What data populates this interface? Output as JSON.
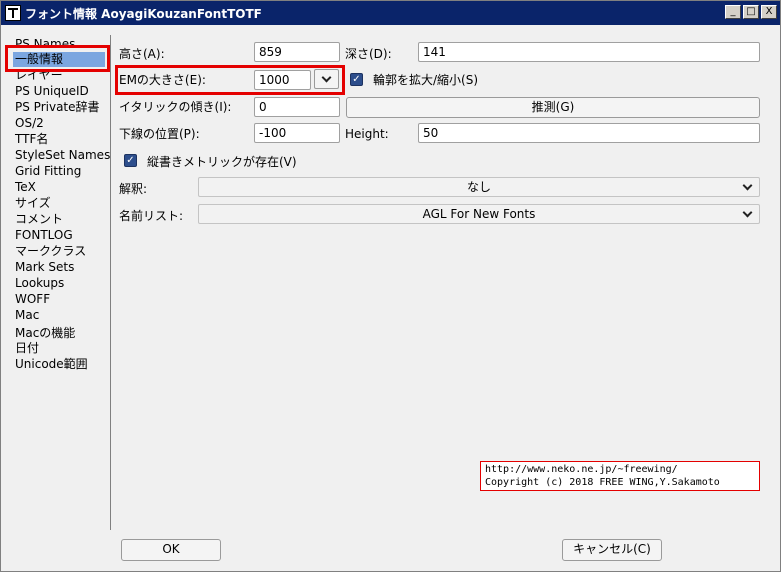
{
  "window": {
    "title": "フォント情報 AoyagiKouzanFontTOTF",
    "minimize_glyph": "_",
    "maximize_glyph": "□",
    "close_glyph": "X"
  },
  "sidebar": {
    "items": [
      {
        "label": "PS Names"
      },
      {
        "label": "一般情報",
        "selected": true
      },
      {
        "label": "レイヤー"
      },
      {
        "label": "PS UniqueID"
      },
      {
        "label": "PS Private辞書"
      },
      {
        "label": "OS/2"
      },
      {
        "label": "TTF名"
      },
      {
        "label": "StyleSet Names"
      },
      {
        "label": "Grid Fitting"
      },
      {
        "label": "TeX"
      },
      {
        "label": "サイズ"
      },
      {
        "label": "コメント"
      },
      {
        "label": "FONTLOG"
      },
      {
        "label": "マーククラス"
      },
      {
        "label": "Mark Sets"
      },
      {
        "label": "Lookups"
      },
      {
        "label": "WOFF"
      },
      {
        "label": "Mac"
      },
      {
        "label": "Macの機能"
      },
      {
        "label": "日付"
      },
      {
        "label": "Unicode範囲"
      }
    ]
  },
  "form": {
    "ascent_label": "高さ(A):",
    "ascent_value": "859",
    "descent_label": "深さ(D):",
    "descent_value": "141",
    "em_label": "EMの大きさ(E):",
    "em_value": "1000",
    "scale_outlines_label": "輪郭を拡大/縮小(S)",
    "italic_label": "イタリックの傾き(I):",
    "italic_value": "0",
    "guess_button": "推測(G)",
    "underline_pos_label": "下線の位置(P):",
    "underline_pos_value": "-100",
    "height_label": "Height:",
    "height_value": "50",
    "vertical_metrics_label": "縦書きメトリックが存在(V)",
    "interpretation_label": "解釈:",
    "interpretation_value": "なし",
    "name_list_label": "名前リスト:",
    "name_list_value": "AGL For New Fonts"
  },
  "copyright": {
    "line1": "http://www.neko.ne.jp/~freewing/",
    "line2": "Copyright (c) 2018 FREE WING,Y.Sakamoto"
  },
  "footer": {
    "ok_label": "OK",
    "cancel_label": "キャンセル(C)"
  },
  "colors": {
    "titlebar": "#0a246a",
    "selection": "#7ba6e0",
    "highlight_box": "#e40000",
    "checkbox": "#2d4e8c"
  }
}
